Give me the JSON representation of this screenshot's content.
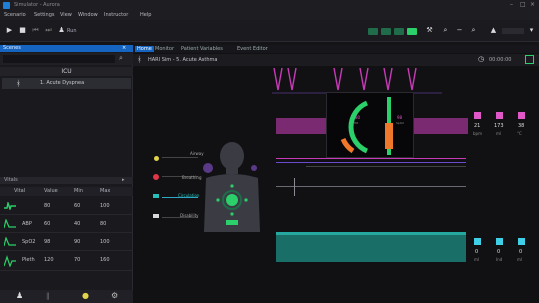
{
  "window": {
    "title": "Simulator - Aurora"
  },
  "menu": [
    "Scenario",
    "Settings",
    "View",
    "Window",
    "Instructor",
    "Help"
  ],
  "toolbar": {
    "user_label": "Run"
  },
  "left": {
    "panel_title": "Scenes",
    "scene_header": "ICU",
    "scene_item": "1. Acute Dyspnea",
    "vitals_panel_title": "Vitals",
    "vitals_columns": [
      "Vital",
      "Value",
      "Min",
      "Max"
    ],
    "vitals": [
      {
        "name": "HR",
        "value": "80",
        "min": "60",
        "max": "100",
        "color": "#2bd06a"
      },
      {
        "name": "ABP",
        "value": "60",
        "min": "40",
        "max": "80",
        "color": "#e0364a"
      },
      {
        "name": "SpO2",
        "value": "98",
        "min": "90",
        "max": "100",
        "color": "#2bd06a"
      },
      {
        "name": "Pleth",
        "value": "120",
        "min": "70",
        "max": "160",
        "color": "#2bd06a"
      }
    ]
  },
  "main": {
    "tabs": [
      "Home",
      "Monitor",
      "Patient Variables",
      "Event Editor"
    ],
    "subtitle": "HARI Sim - 5. Acute Asthma",
    "body_controls": [
      {
        "label": "Airway",
        "color": "#e2d34a"
      },
      {
        "label": "Breathing",
        "color": "#e0364a"
      },
      {
        "label": "Circulation",
        "color": "#27c0b8"
      },
      {
        "label": "Disability",
        "color": "#d8d8d8"
      }
    ],
    "monitor_values": [
      {
        "value": "80",
        "unit": "HR"
      },
      {
        "value": "98",
        "unit": "SpO2"
      }
    ],
    "right_stats_top": [
      {
        "value": "21",
        "unit": "bpm"
      },
      {
        "value": "173",
        "unit": "ml"
      },
      {
        "value": "38",
        "unit": "°C"
      }
    ],
    "right_stats_bottom": [
      {
        "value": "0",
        "unit": "ml"
      },
      {
        "value": "0",
        "unit": "Ind"
      },
      {
        "value": "0",
        "unit": "ml"
      }
    ],
    "zoom": "00:00:00"
  },
  "colors": {
    "accent": "#1565c0",
    "magenta": "#c83ab8",
    "teal": "#1fa9a0",
    "cyan": "#3fd0e8",
    "orange": "#f0782a",
    "green": "#2bd06a",
    "pink": "#e057c8",
    "purple": "#5a3a88"
  }
}
